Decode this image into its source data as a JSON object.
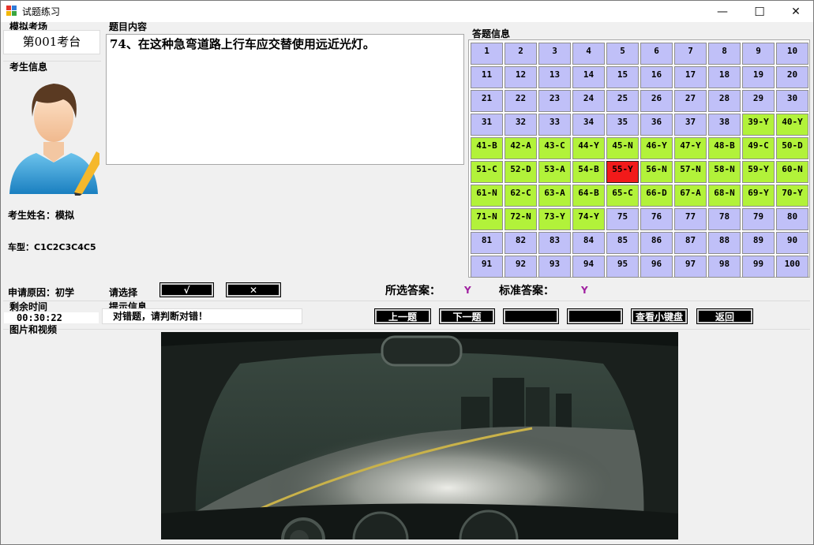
{
  "window": {
    "title": "试题练习",
    "minimize_glyph": "—",
    "maximize_glyph": "☐",
    "close_glyph": "✕"
  },
  "exam_room": {
    "label": "模拟考场",
    "value": "第001考台"
  },
  "candidate": {
    "label": "考生信息",
    "name": "考生姓名：模拟",
    "vehicle_type": "车型：C1C2C3C4C5",
    "reason": "申请原因：初学"
  },
  "question": {
    "label": "题目内容",
    "text": "74、在这种急弯道路上行车应交替使用远近光灯。"
  },
  "answer_sheet": {
    "label": "答题信息",
    "colors": {
      "unanswered": "#c0c0f8",
      "correct": "#b2f23a",
      "wrong": "#f21a1a"
    },
    "cells": [
      {
        "text": "1",
        "state": "unanswered"
      },
      {
        "text": "2",
        "state": "unanswered"
      },
      {
        "text": "3",
        "state": "unanswered"
      },
      {
        "text": "4",
        "state": "unanswered"
      },
      {
        "text": "5",
        "state": "unanswered"
      },
      {
        "text": "6",
        "state": "unanswered"
      },
      {
        "text": "7",
        "state": "unanswered"
      },
      {
        "text": "8",
        "state": "unanswered"
      },
      {
        "text": "9",
        "state": "unanswered"
      },
      {
        "text": "10",
        "state": "unanswered"
      },
      {
        "text": "11",
        "state": "unanswered"
      },
      {
        "text": "12",
        "state": "unanswered"
      },
      {
        "text": "13",
        "state": "unanswered"
      },
      {
        "text": "14",
        "state": "unanswered"
      },
      {
        "text": "15",
        "state": "unanswered"
      },
      {
        "text": "16",
        "state": "unanswered"
      },
      {
        "text": "17",
        "state": "unanswered"
      },
      {
        "text": "18",
        "state": "unanswered"
      },
      {
        "text": "19",
        "state": "unanswered"
      },
      {
        "text": "20",
        "state": "unanswered"
      },
      {
        "text": "21",
        "state": "unanswered"
      },
      {
        "text": "22",
        "state": "unanswered"
      },
      {
        "text": "23",
        "state": "unanswered"
      },
      {
        "text": "24",
        "state": "unanswered"
      },
      {
        "text": "25",
        "state": "unanswered"
      },
      {
        "text": "26",
        "state": "unanswered"
      },
      {
        "text": "27",
        "state": "unanswered"
      },
      {
        "text": "28",
        "state": "unanswered"
      },
      {
        "text": "29",
        "state": "unanswered"
      },
      {
        "text": "30",
        "state": "unanswered"
      },
      {
        "text": "31",
        "state": "unanswered"
      },
      {
        "text": "32",
        "state": "unanswered"
      },
      {
        "text": "33",
        "state": "unanswered"
      },
      {
        "text": "34",
        "state": "unanswered"
      },
      {
        "text": "35",
        "state": "unanswered"
      },
      {
        "text": "36",
        "state": "unanswered"
      },
      {
        "text": "37",
        "state": "unanswered"
      },
      {
        "text": "38",
        "state": "unanswered"
      },
      {
        "text": "39-Y",
        "state": "correct"
      },
      {
        "text": "40-Y",
        "state": "correct"
      },
      {
        "text": "41-B",
        "state": "correct"
      },
      {
        "text": "42-A",
        "state": "correct"
      },
      {
        "text": "43-C",
        "state": "correct"
      },
      {
        "text": "44-Y",
        "state": "correct"
      },
      {
        "text": "45-N",
        "state": "correct"
      },
      {
        "text": "46-Y",
        "state": "correct"
      },
      {
        "text": "47-Y",
        "state": "correct"
      },
      {
        "text": "48-B",
        "state": "correct"
      },
      {
        "text": "49-C",
        "state": "correct"
      },
      {
        "text": "50-D",
        "state": "correct"
      },
      {
        "text": "51-C",
        "state": "correct"
      },
      {
        "text": "52-D",
        "state": "correct"
      },
      {
        "text": "53-A",
        "state": "correct"
      },
      {
        "text": "54-B",
        "state": "correct"
      },
      {
        "text": "55-Y",
        "state": "wrong"
      },
      {
        "text": "56-N",
        "state": "correct"
      },
      {
        "text": "57-N",
        "state": "correct"
      },
      {
        "text": "58-N",
        "state": "correct"
      },
      {
        "text": "59-Y",
        "state": "correct"
      },
      {
        "text": "60-N",
        "state": "correct"
      },
      {
        "text": "61-N",
        "state": "correct"
      },
      {
        "text": "62-C",
        "state": "correct"
      },
      {
        "text": "63-A",
        "state": "correct"
      },
      {
        "text": "64-B",
        "state": "correct"
      },
      {
        "text": "65-C",
        "state": "correct"
      },
      {
        "text": "66-D",
        "state": "correct"
      },
      {
        "text": "67-A",
        "state": "correct"
      },
      {
        "text": "68-N",
        "state": "correct"
      },
      {
        "text": "69-Y",
        "state": "correct"
      },
      {
        "text": "70-Y",
        "state": "correct"
      },
      {
        "text": "71-N",
        "state": "correct"
      },
      {
        "text": "72-N",
        "state": "correct"
      },
      {
        "text": "73-Y",
        "state": "correct"
      },
      {
        "text": "74-Y",
        "state": "correct"
      },
      {
        "text": "75",
        "state": "unanswered"
      },
      {
        "text": "76",
        "state": "unanswered"
      },
      {
        "text": "77",
        "state": "unanswered"
      },
      {
        "text": "78",
        "state": "unanswered"
      },
      {
        "text": "79",
        "state": "unanswered"
      },
      {
        "text": "80",
        "state": "unanswered"
      },
      {
        "text": "81",
        "state": "unanswered"
      },
      {
        "text": "82",
        "state": "unanswered"
      },
      {
        "text": "83",
        "state": "unanswered"
      },
      {
        "text": "84",
        "state": "unanswered"
      },
      {
        "text": "85",
        "state": "unanswered"
      },
      {
        "text": "86",
        "state": "unanswered"
      },
      {
        "text": "87",
        "state": "unanswered"
      },
      {
        "text": "88",
        "state": "unanswered"
      },
      {
        "text": "89",
        "state": "unanswered"
      },
      {
        "text": "90",
        "state": "unanswered"
      },
      {
        "text": "91",
        "state": "unanswered"
      },
      {
        "text": "92",
        "state": "unanswered"
      },
      {
        "text": "93",
        "state": "unanswered"
      },
      {
        "text": "94",
        "state": "unanswered"
      },
      {
        "text": "95",
        "state": "unanswered"
      },
      {
        "text": "96",
        "state": "unanswered"
      },
      {
        "text": "97",
        "state": "unanswered"
      },
      {
        "text": "98",
        "state": "unanswered"
      },
      {
        "text": "99",
        "state": "unanswered"
      },
      {
        "text": "100",
        "state": "unanswered"
      }
    ]
  },
  "choice": {
    "label": "请选择",
    "correct_button": "√",
    "wrong_button": "✕"
  },
  "answers": {
    "selected_label": "所选答案：",
    "selected_value": "Y",
    "standard_label": "标准答案：",
    "standard_value": "Y"
  },
  "timer": {
    "label": "剩余时间",
    "value": "00:30:22"
  },
  "hint": {
    "label": "提示信息",
    "text": "对错题，请判断对错！"
  },
  "nav_buttons": {
    "prev": "上一题",
    "next": "下一题",
    "blank1": "",
    "blank2": "",
    "keyboard": "查看小键盘",
    "back": "返回"
  },
  "media": {
    "label": "图片和视频"
  }
}
